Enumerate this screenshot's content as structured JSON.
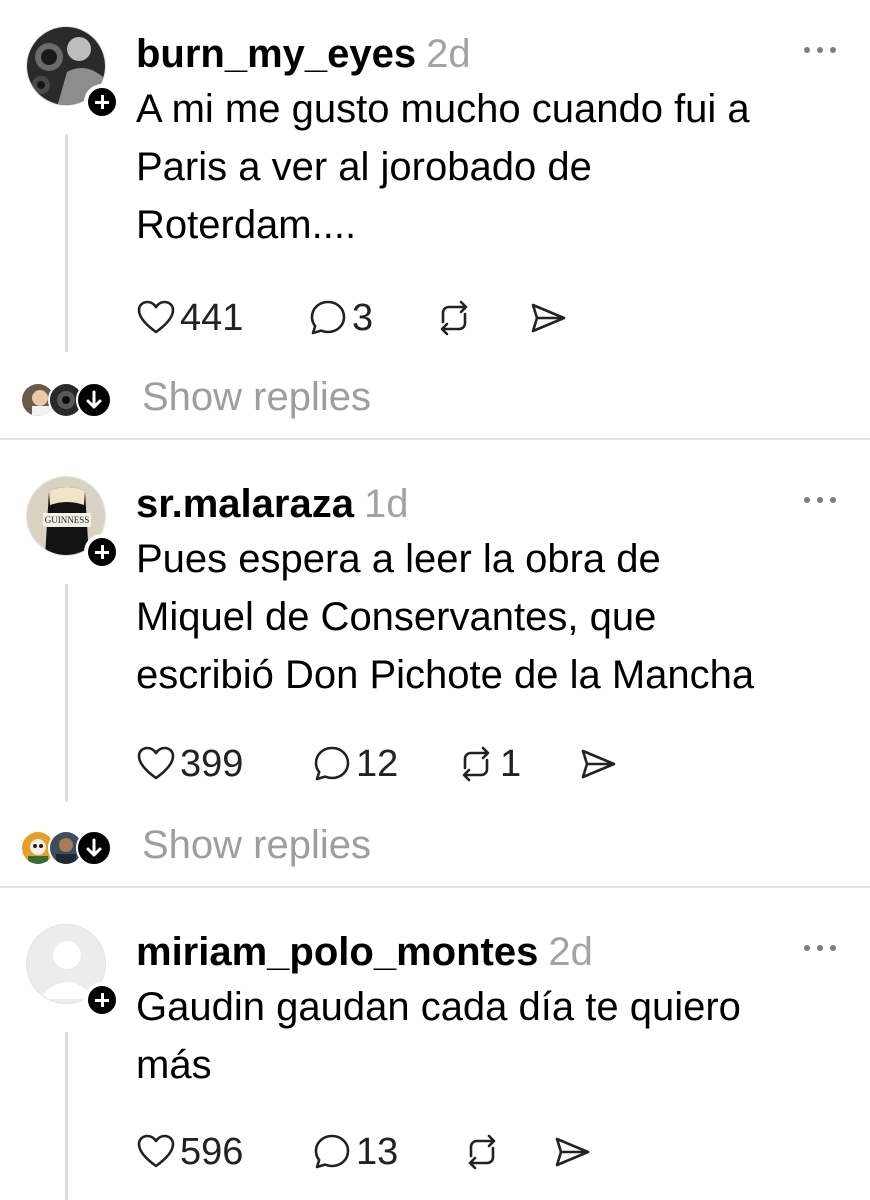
{
  "posts": [
    {
      "username": "burn_my_eyes",
      "time": "2d",
      "lines": [
        "A mi me gusto mucho cuando fui a",
        "Paris a ver al jorobado de",
        "Roterdam...."
      ],
      "likes": "441",
      "comments": "3",
      "reposts": "",
      "show_replies": "Show replies"
    },
    {
      "username": "sr.malaraza",
      "time": "1d",
      "avatar_text": "GUINNESS",
      "lines": [
        "Pues espera a leer la obra de",
        "Miquel de Conservantes, que",
        "escribió Don Pichote de la Mancha"
      ],
      "likes": "399",
      "comments": "12",
      "reposts": "1",
      "show_replies": "Show replies"
    },
    {
      "username": "miriam_polo_montes",
      "time": "2d",
      "lines": [
        "Gaudin gaudan cada día te quiero",
        "más"
      ],
      "likes": "596",
      "comments": "13",
      "reposts": ""
    }
  ],
  "icons": {
    "like": "heart-icon",
    "comment": "speech-bubble-icon",
    "repost": "repost-icon",
    "share": "send-icon",
    "more": "more-dots-icon",
    "follow": "plus-icon",
    "expand": "arrow-down-icon"
  },
  "colors": {
    "text": "#000000",
    "muted": "#a3a3a3",
    "thread": "#dcdcdc",
    "divider": "#e6e6e6"
  }
}
